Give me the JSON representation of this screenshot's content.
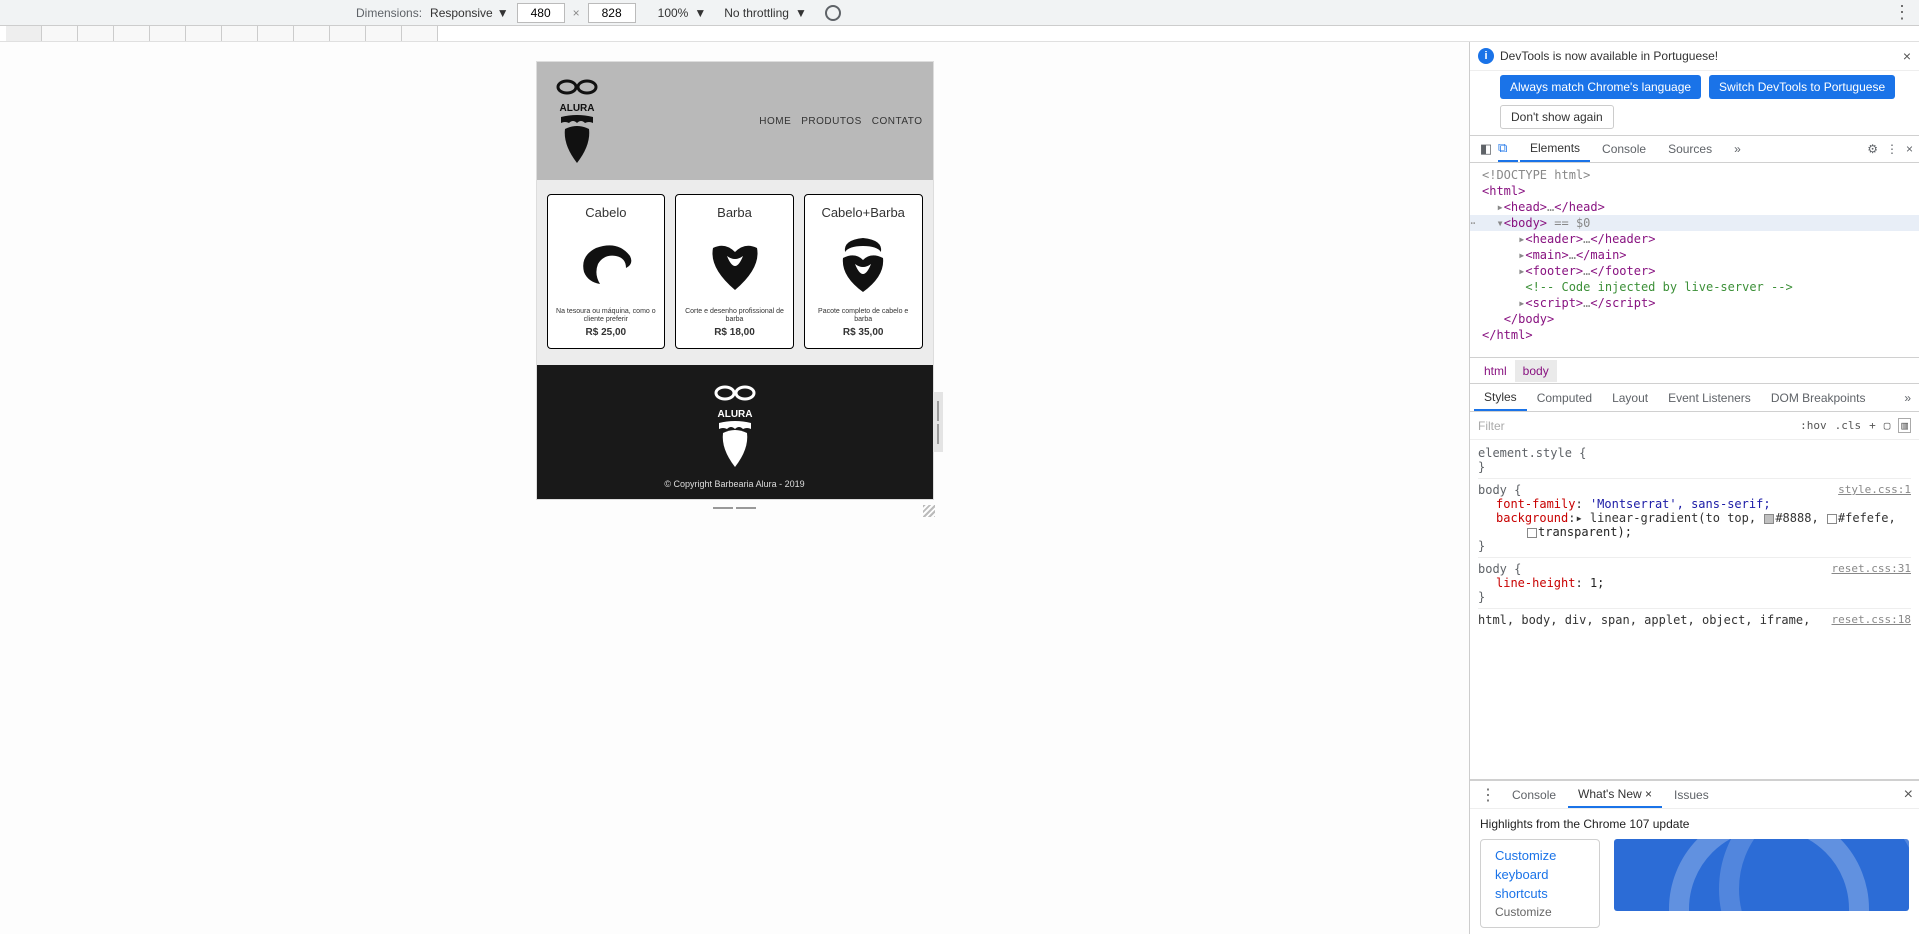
{
  "toolbar": {
    "dimensions_label": "Dimensions:",
    "device": "Responsive",
    "width": "480",
    "height": "828",
    "zoom": "100%",
    "throttling": "No throttling"
  },
  "infobar": {
    "message": "DevTools is now available in Portuguese!",
    "btn_match": "Always match Chrome's language",
    "btn_switch": "Switch DevTools to Portuguese",
    "btn_dontshow": "Don't show again"
  },
  "tabs": {
    "elements": "Elements",
    "console": "Console",
    "sources": "Sources"
  },
  "dom": {
    "doctype": "<!DOCTYPE html>",
    "html_open": "<html>",
    "head_open": "<head>",
    "head_close": "</head>",
    "body_open": "<body>",
    "body_marker": " == $0",
    "header_open": "<header>",
    "header_close": "</header>",
    "main_open": "<main>",
    "main_close": "</main>",
    "footer_open": "<footer>",
    "footer_close": "</footer>",
    "comment": "<!-- Code injected by live-server -->",
    "script_open": "<script>",
    "script_close": "</script>",
    "body_close": "</body>",
    "html_close": "</html>"
  },
  "crumbs": {
    "html": "html",
    "body": "body"
  },
  "subtabs": {
    "styles": "Styles",
    "computed": "Computed",
    "layout": "Layout",
    "events": "Event Listeners",
    "dom_bp": "DOM Breakpoints"
  },
  "filter": {
    "placeholder": "Filter",
    "hov": ":hov",
    "cls": ".cls"
  },
  "rules": {
    "element_style": "element.style {",
    "close": "}",
    "body1": {
      "sel": "body {",
      "origin": "style.css:1",
      "p1n": "font-family",
      "p1v": "'Montserrat', sans-serif;",
      "p2n": "background",
      "p2pre": "▸ linear-gradient(to top, ",
      "p2c1": "#8888",
      "p2mid": ", ",
      "p2c2": "#fefefe",
      "p2end": ",",
      "p2line2": "transparent);"
    },
    "body2": {
      "sel": "body {",
      "origin": "reset.css:31",
      "p1n": "line-height",
      "p1v": "1;"
    },
    "overflow": "html, body, div, span, applet, object, iframe,",
    "overflow_origin": "reset.css:18"
  },
  "drawer": {
    "console": "Console",
    "whatsnew": "What's New",
    "issues": "Issues",
    "title": "Highlights from the Chrome 107 update",
    "link1": "Customize",
    "link2": "keyboard",
    "link3": "shortcuts",
    "link4": "Customize"
  },
  "page": {
    "nav": {
      "home": "HOME",
      "produtos": "PRODUTOS",
      "contato": "CONTATO"
    },
    "cards": [
      {
        "title": "Cabelo",
        "desc": "Na tesoura ou máquina, como o cliente preferir",
        "price": "R$ 25,00"
      },
      {
        "title": "Barba",
        "desc": "Corte e desenho profissional de barba",
        "price": "R$ 18,00"
      },
      {
        "title": "Cabelo+Barba",
        "desc": "Pacote completo de cabelo e barba",
        "price": "R$ 35,00"
      }
    ],
    "footer": "© Copyright Barbearia Alura - 2019"
  }
}
